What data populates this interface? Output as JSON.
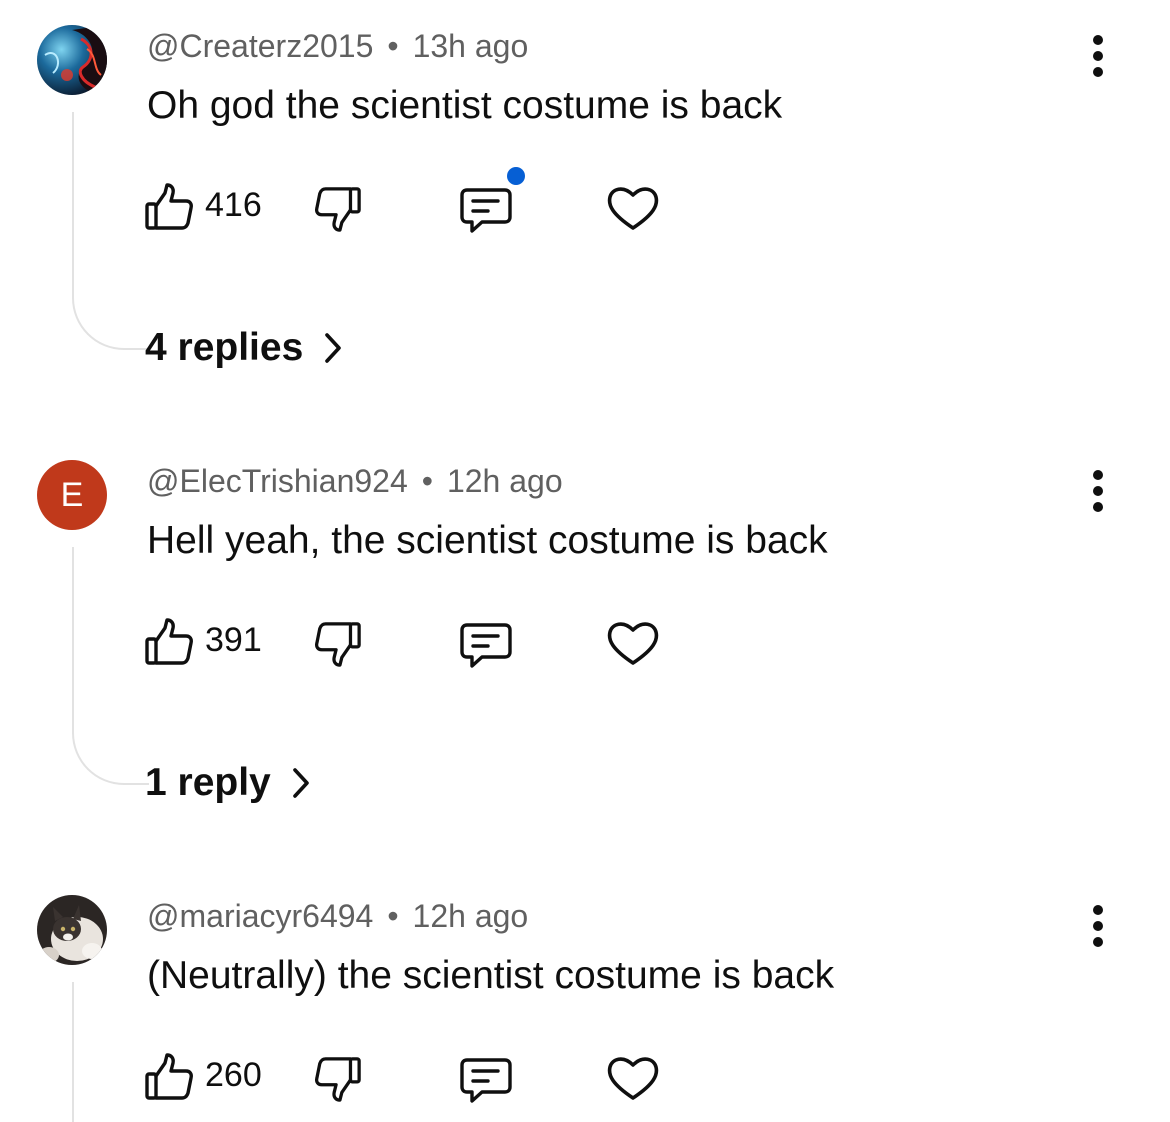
{
  "comments": [
    {
      "handle": "@Createrz2015",
      "time": "13h ago",
      "text": "Oh god the scientist costume is back",
      "likes": "416",
      "replies_label": "4 replies",
      "has_notification_dot": true,
      "avatar": {
        "type": "image",
        "description": "blue red swirl avatar"
      }
    },
    {
      "handle": "@ElecTrishian924",
      "time": "12h ago",
      "text": "Hell yeah, the scientist costume is back",
      "likes": "391",
      "replies_label": "1 reply",
      "has_notification_dot": false,
      "avatar": {
        "type": "letter",
        "letter": "E",
        "color": "#c0391b"
      }
    },
    {
      "handle": "@mariacyr6494",
      "time": "12h ago",
      "text": "(Neutrally) the scientist costume is back",
      "likes": "260",
      "has_notification_dot": false,
      "avatar": {
        "type": "image",
        "description": "cat photo avatar"
      }
    }
  ],
  "meta_separator": "•",
  "icons": {
    "like": "thumbs-up-icon",
    "dislike": "thumbs-down-icon",
    "reply": "comment-icon",
    "heart": "heart-icon",
    "more": "more-vertical-icon",
    "replies_chevron": "chevron-right-icon"
  },
  "colors": {
    "text": "#0f0f0f",
    "meta": "#606060",
    "notification_dot": "#065fd4",
    "letter_avatar": "#c0391b"
  }
}
